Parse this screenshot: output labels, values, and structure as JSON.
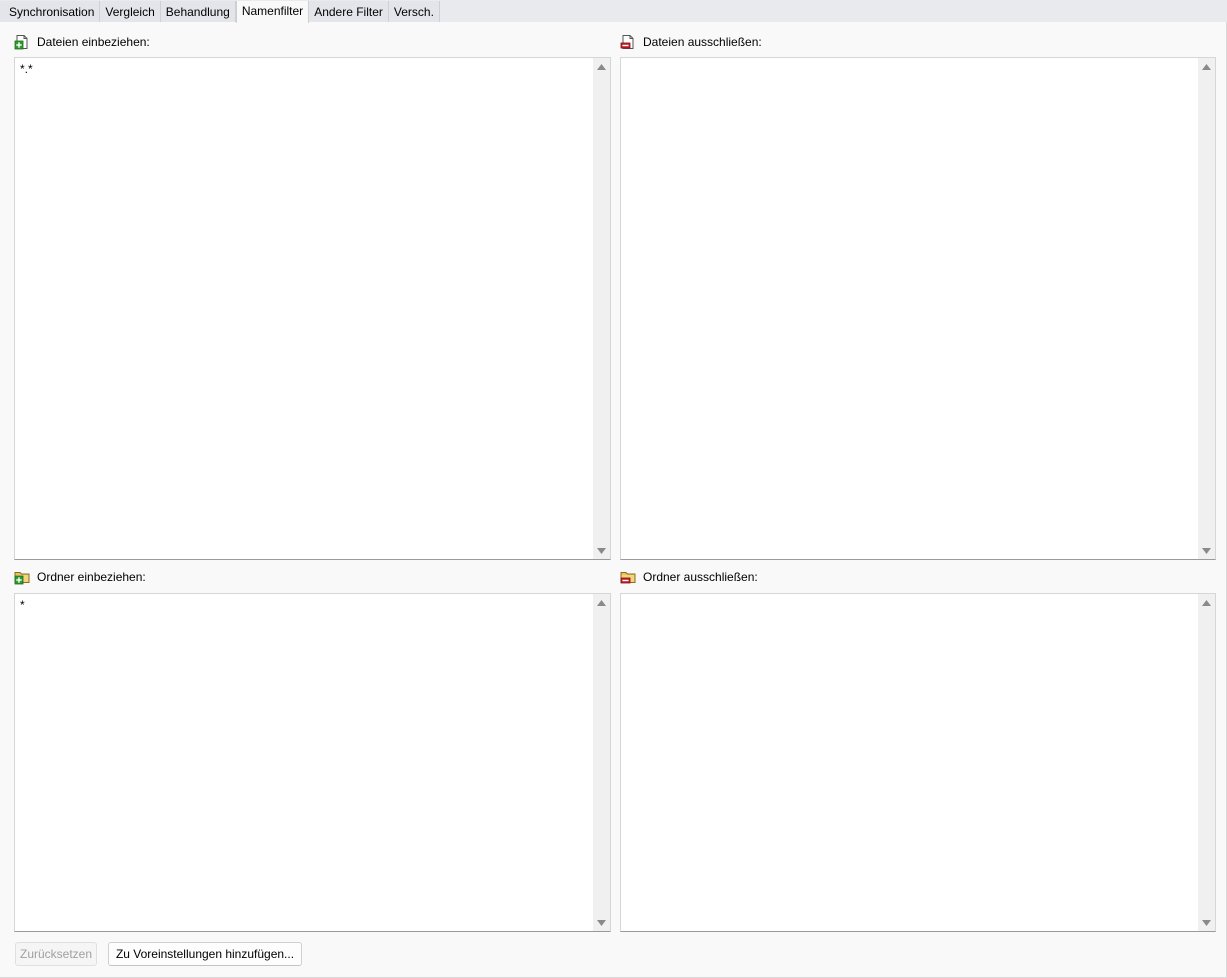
{
  "tabs": [
    {
      "label": "Synchronisation",
      "active": false
    },
    {
      "label": "Vergleich",
      "active": false
    },
    {
      "label": "Behandlung",
      "active": false
    },
    {
      "label": "Namenfilter",
      "active": true
    },
    {
      "label": "Andere Filter",
      "active": false
    },
    {
      "label": "Versch.",
      "active": false
    }
  ],
  "include_files": {
    "label": "Dateien einbeziehen:",
    "icon": "file-include-icon",
    "value": "*.*"
  },
  "exclude_files": {
    "label": "Dateien ausschließen:",
    "icon": "file-exclude-icon",
    "value": ""
  },
  "include_folders": {
    "label": "Ordner einbeziehen:",
    "icon": "folder-include-icon",
    "value": "*"
  },
  "exclude_folders": {
    "label": "Ordner ausschließen:",
    "icon": "folder-exclude-icon",
    "value": ""
  },
  "buttons": {
    "reset": {
      "label": "Zurücksetzen",
      "disabled": true
    },
    "add_preset": {
      "label": "Zu Voreinstellungen hinzufügen..."
    }
  },
  "colors": {
    "panel_bg": "#f9f9f9",
    "tabstrip_bg": "#e9eaee",
    "textbox_bg": "#ffffff",
    "scrollbar_bg": "#f0f0f0",
    "include_green": "#2e9d2e",
    "exclude_red": "#c8202a",
    "folder_yellow": "#e8c25a"
  }
}
